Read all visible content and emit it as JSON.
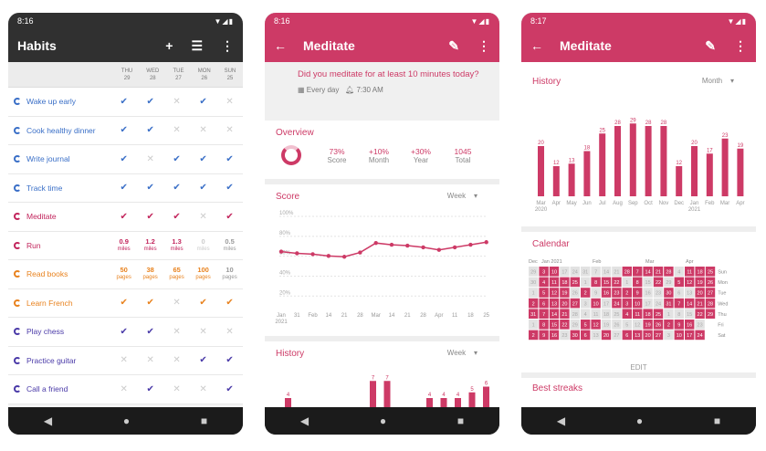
{
  "habits_screen": {
    "status_time": "8:16",
    "title": "Habits",
    "days": [
      {
        "d": "THU",
        "n": "29"
      },
      {
        "d": "WED",
        "n": "28"
      },
      {
        "d": "TUE",
        "n": "27"
      },
      {
        "d": "MON",
        "n": "26"
      },
      {
        "d": "SUN",
        "n": "25"
      }
    ],
    "habits": [
      {
        "name": "Wake up early",
        "color": "#3a6fc7",
        "cells": [
          "✔",
          "✔",
          "✕",
          "✔",
          "✕"
        ]
      },
      {
        "name": "Cook healthy dinner",
        "color": "#3a6fc7",
        "cells": [
          "✔",
          "✔",
          "✕",
          "✕",
          "✕"
        ]
      },
      {
        "name": "Write journal",
        "color": "#3a6fc7",
        "cells": [
          "✔",
          "✕",
          "✔",
          "✔",
          "✔"
        ]
      },
      {
        "name": "Track time",
        "color": "#3a6fc7",
        "cells": [
          "✔",
          "✔",
          "✔",
          "✔",
          "✔"
        ]
      },
      {
        "name": "Meditate",
        "color": "#c2255c",
        "cells": [
          "✔",
          "✔",
          "✔",
          "✕",
          "✔"
        ]
      },
      {
        "name": "Run",
        "color": "#c2255c",
        "cells": [
          {
            "v": "0.9",
            "u": "miles"
          },
          {
            "v": "1.2",
            "u": "miles"
          },
          {
            "v": "1.3",
            "u": "miles"
          },
          {
            "v": "0",
            "u": "miles"
          },
          {
            "v": "0.5",
            "u": "miles"
          }
        ]
      },
      {
        "name": "Read books",
        "color": "#e8821e",
        "cells": [
          {
            "v": "50",
            "u": "pages"
          },
          {
            "v": "38",
            "u": "pages"
          },
          {
            "v": "65",
            "u": "pages"
          },
          {
            "v": "100",
            "u": "pages"
          },
          {
            "v": "10",
            "u": "pages"
          }
        ]
      },
      {
        "name": "Learn French",
        "color": "#e8821e",
        "cells": [
          "✔",
          "✔",
          "✕",
          "✔",
          "✔"
        ]
      },
      {
        "name": "Play chess",
        "color": "#4a3aa8",
        "cells": [
          "✔",
          "✔",
          "✕",
          "✕",
          "✕"
        ]
      },
      {
        "name": "Practice guitar",
        "color": "#4a3aa8",
        "cells": [
          "✕",
          "✕",
          "✕",
          "✔",
          "✔"
        ]
      },
      {
        "name": "Call a friend",
        "color": "#4a3aa8",
        "cells": [
          "✕",
          "✔",
          "✕",
          "✕",
          "✔"
        ]
      }
    ]
  },
  "meditate_screen": {
    "status_time": "8:16",
    "title": "Meditate",
    "question": "Did you meditate for at least 10 minutes today?",
    "frequency": "Every day",
    "reminder": "7:30 AM",
    "overview_title": "Overview",
    "stats": [
      {
        "n": "73%",
        "l": "Score"
      },
      {
        "n": "+10%",
        "l": "Month"
      },
      {
        "n": "+30%",
        "l": "Year"
      },
      {
        "n": "1045",
        "l": "Total"
      }
    ],
    "score_title": "Score",
    "score_period": "Week",
    "history_title": "History",
    "history_period": "Week"
  },
  "history_screen": {
    "status_time": "8:17",
    "title": "Meditate",
    "history_title": "History",
    "history_period": "Month",
    "calendar_title": "Calendar",
    "cal_months": [
      "Dec",
      "Jan 2021",
      "Feb",
      "Mar",
      "Apr"
    ],
    "cal_days": [
      "Sun",
      "Mon",
      "Tue",
      "Wed",
      "Thu",
      "Fri",
      "Sat"
    ],
    "edit_label": "EDIT",
    "streaks_title": "Best streaks"
  },
  "chart_data": [
    {
      "type": "line",
      "title": "Score",
      "x": [
        "Jan 2021",
        "31",
        "Feb",
        "14",
        "21",
        "28",
        "Mar",
        "14",
        "21",
        "28",
        "Apr",
        "11",
        "18",
        "25"
      ],
      "values": [
        61,
        59,
        58,
        56,
        55,
        60,
        71,
        69,
        68,
        66,
        63,
        66,
        69,
        72
      ],
      "yticks": [
        "100%",
        "80%",
        "60%",
        "40%",
        "20%"
      ],
      "ylim": [
        0,
        100
      ]
    },
    {
      "type": "bar",
      "title": "History",
      "values": [
        4,
        0,
        0,
        0,
        0,
        0,
        7,
        7,
        0,
        0,
        4,
        4,
        4,
        5,
        6
      ],
      "labels": [
        "4",
        "",
        "",
        "",
        "",
        "",
        "7",
        "7",
        "",
        "",
        "4",
        "4",
        "4",
        "5",
        "6"
      ],
      "ylim": [
        0,
        8
      ]
    },
    {
      "type": "bar",
      "title": "History",
      "categories": [
        "Mar 2020",
        "Apr",
        "May",
        "Jun",
        "Jul",
        "Aug",
        "Sep",
        "Oct",
        "Nov",
        "Dec",
        "Jan 2021",
        "Feb",
        "Mar",
        "Apr"
      ],
      "values": [
        20,
        12,
        13,
        18,
        25,
        28,
        29,
        28,
        28,
        12,
        20,
        17,
        23,
        19
      ],
      "ylim": [
        0,
        32
      ]
    }
  ],
  "calendar": {
    "rows": [
      [
        {
          "n": "29",
          "s": 0
        },
        {
          "n": "3",
          "s": 1
        },
        {
          "n": "10",
          "s": 1
        },
        {
          "n": "17",
          "s": 0
        },
        {
          "n": "24",
          "s": 0
        },
        {
          "n": "31",
          "s": 0
        },
        {
          "n": "7",
          "s": 0
        },
        {
          "n": "14",
          "s": 0
        },
        {
          "n": "21",
          "s": 0
        },
        {
          "n": "28",
          "s": 1
        },
        {
          "n": "7",
          "s": 1
        },
        {
          "n": "14",
          "s": 1
        },
        {
          "n": "21",
          "s": 1
        },
        {
          "n": "28",
          "s": 1
        },
        {
          "n": "4",
          "s": 0
        },
        {
          "n": "11",
          "s": 1
        },
        {
          "n": "18",
          "s": 1
        },
        {
          "n": "25",
          "s": 1
        }
      ],
      [
        {
          "n": "30",
          "s": 0
        },
        {
          "n": "4",
          "s": 1
        },
        {
          "n": "11",
          "s": 1
        },
        {
          "n": "18",
          "s": 1
        },
        {
          "n": "25",
          "s": 1
        },
        {
          "n": "1",
          "s": 0
        },
        {
          "n": "8",
          "s": 1
        },
        {
          "n": "15",
          "s": 1
        },
        {
          "n": "22",
          "s": 1
        },
        {
          "n": "1",
          "s": 0
        },
        {
          "n": "8",
          "s": 1
        },
        {
          "n": "15",
          "s": 0
        },
        {
          "n": "22",
          "s": 1
        },
        {
          "n": "29",
          "s": 0
        },
        {
          "n": "5",
          "s": 1
        },
        {
          "n": "12",
          "s": 1
        },
        {
          "n": "19",
          "s": 1
        },
        {
          "n": "26",
          "s": 1
        }
      ],
      [
        {
          "n": "1",
          "s": 0
        },
        {
          "n": "5",
          "s": 1
        },
        {
          "n": "12",
          "s": 1
        },
        {
          "n": "19",
          "s": 1
        },
        {
          "n": "26",
          "s": 0
        },
        {
          "n": "2",
          "s": 1
        },
        {
          "n": "9",
          "s": 0
        },
        {
          "n": "16",
          "s": 1
        },
        {
          "n": "23",
          "s": 1
        },
        {
          "n": "2",
          "s": 1
        },
        {
          "n": "9",
          "s": 1
        },
        {
          "n": "16",
          "s": 0
        },
        {
          "n": "23",
          "s": 0
        },
        {
          "n": "30",
          "s": 1
        },
        {
          "n": "6",
          "s": 0
        },
        {
          "n": "13",
          "s": 0
        },
        {
          "n": "20",
          "s": 1
        },
        {
          "n": "27",
          "s": 1
        }
      ],
      [
        {
          "n": "2",
          "s": 1
        },
        {
          "n": "6",
          "s": 1
        },
        {
          "n": "13",
          "s": 1
        },
        {
          "n": "20",
          "s": 1
        },
        {
          "n": "27",
          "s": 1
        },
        {
          "n": "3",
          "s": 0
        },
        {
          "n": "10",
          "s": 1
        },
        {
          "n": "17",
          "s": 0
        },
        {
          "n": "24",
          "s": 1
        },
        {
          "n": "3",
          "s": 1
        },
        {
          "n": "10",
          "s": 1
        },
        {
          "n": "17",
          "s": 0
        },
        {
          "n": "24",
          "s": 0
        },
        {
          "n": "31",
          "s": 1
        },
        {
          "n": "7",
          "s": 1
        },
        {
          "n": "14",
          "s": 1
        },
        {
          "n": "21",
          "s": 1
        },
        {
          "n": "28",
          "s": 1
        }
      ],
      [
        {
          "n": "31",
          "s": 1
        },
        {
          "n": "7",
          "s": 1
        },
        {
          "n": "14",
          "s": 1
        },
        {
          "n": "21",
          "s": 1
        },
        {
          "n": "28",
          "s": 0
        },
        {
          "n": "4",
          "s": 0
        },
        {
          "n": "11",
          "s": 0
        },
        {
          "n": "18",
          "s": 0
        },
        {
          "n": "25",
          "s": 0
        },
        {
          "n": "4",
          "s": 1
        },
        {
          "n": "11",
          "s": 1
        },
        {
          "n": "18",
          "s": 1
        },
        {
          "n": "25",
          "s": 1
        },
        {
          "n": "1",
          "s": 0
        },
        {
          "n": "8",
          "s": 0
        },
        {
          "n": "15",
          "s": 0
        },
        {
          "n": "22",
          "s": 1
        },
        {
          "n": "29",
          "s": 1
        }
      ],
      [
        {
          "n": "1",
          "s": 0
        },
        {
          "n": "8",
          "s": 1
        },
        {
          "n": "15",
          "s": 1
        },
        {
          "n": "22",
          "s": 1
        },
        {
          "n": "29",
          "s": 0
        },
        {
          "n": "5",
          "s": 1
        },
        {
          "n": "12",
          "s": 1
        },
        {
          "n": "19",
          "s": 0
        },
        {
          "n": "26",
          "s": 0
        },
        {
          "n": "5",
          "s": 0
        },
        {
          "n": "12",
          "s": 0
        },
        {
          "n": "19",
          "s": 1
        },
        {
          "n": "26",
          "s": 1
        },
        {
          "n": "2",
          "s": 1
        },
        {
          "n": "9",
          "s": 1
        },
        {
          "n": "16",
          "s": 1
        },
        {
          "n": "23",
          "s": 0
        },
        {
          "n": "",
          "s": -1
        }
      ],
      [
        {
          "n": "2",
          "s": 1
        },
        {
          "n": "9",
          "s": 1
        },
        {
          "n": "16",
          "s": 1
        },
        {
          "n": "23",
          "s": 0
        },
        {
          "n": "30",
          "s": 1
        },
        {
          "n": "6",
          "s": 1
        },
        {
          "n": "13",
          "s": 0
        },
        {
          "n": "20",
          "s": 1
        },
        {
          "n": "27",
          "s": 0
        },
        {
          "n": "6",
          "s": 1
        },
        {
          "n": "13",
          "s": 1
        },
        {
          "n": "20",
          "s": 1
        },
        {
          "n": "27",
          "s": 1
        },
        {
          "n": "3",
          "s": 0
        },
        {
          "n": "10",
          "s": 1
        },
        {
          "n": "17",
          "s": 1
        },
        {
          "n": "24",
          "s": 1
        },
        {
          "n": "",
          "s": -1
        }
      ]
    ]
  }
}
